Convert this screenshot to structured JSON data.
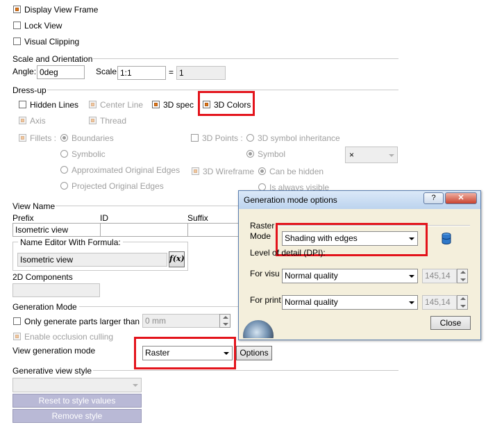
{
  "display": {
    "display_view_frame": "Display View Frame",
    "lock_view": "Lock View",
    "visual_clipping": "Visual Clipping"
  },
  "scale": {
    "section": "Scale and Orientation",
    "angle_label": "Angle:",
    "angle_value": "0deg",
    "scale_label": "Scale:",
    "scale_value": "1:1",
    "equals": "=",
    "ratio_value": "1"
  },
  "dressup": {
    "section": "Dress-up",
    "hidden_lines": "Hidden Lines",
    "center_line": "Center Line",
    "spec_3d": "3D spec",
    "colors_3d": "3D Colors",
    "axis": "Axis",
    "thread": "Thread",
    "fillets": "Fillets :",
    "boundaries": "Boundaries",
    "symbolic": "Symbolic",
    "approx_edges": "Approximated Original Edges",
    "projected_edges": "Projected Original Edges",
    "points_3d": "3D Points :",
    "symbol_inheritance": "3D symbol inheritance",
    "symbol": "Symbol",
    "symbol_value": "×",
    "wireframe_3d": "3D Wireframe",
    "can_be_hidden": "Can be hidden",
    "is_always_visible": "Is always visible"
  },
  "view_name": {
    "section": "View Name",
    "prefix": "Prefix",
    "id": "ID",
    "suffix": "Suffix",
    "prefix_value": "Isometric view",
    "editor_label": "Name Editor With Formula:",
    "editor_value": "Isometric view",
    "fx_icon": "f(x)"
  },
  "components": {
    "section": "2D Components"
  },
  "generation": {
    "section": "Generation Mode",
    "only_larger": "Only generate parts larger than",
    "size_value": "0 mm",
    "occlusion": "Enable occlusion culling",
    "view_mode_label": "View generation mode",
    "view_mode_value": "Raster",
    "options_button": "Options"
  },
  "style": {
    "section": "Generative view style",
    "reset_button": "Reset to style values",
    "remove_button": "Remove style"
  },
  "dialog": {
    "title": "Generation mode options",
    "help": "?",
    "close_x": "✕",
    "raster_label": "Raster",
    "mode_label": "Mode",
    "mode_value": "Shading with edges",
    "lod_label": "Level of detail (DPI):",
    "visu_label": "For visu",
    "visu_value": "Normal quality",
    "visu_dpi": "145,14",
    "print_label": "For print",
    "print_value": "Normal quality",
    "print_dpi": "145,14",
    "close_button": "Close"
  }
}
